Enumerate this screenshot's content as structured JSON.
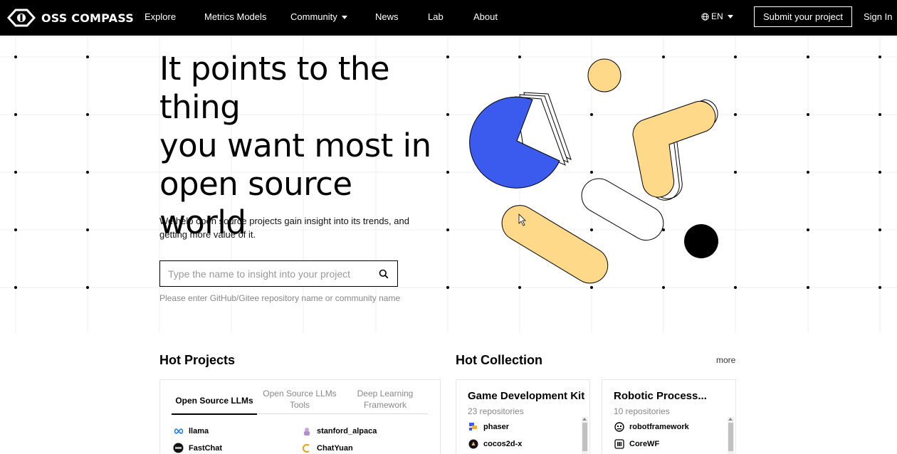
{
  "nav": {
    "brand": "OSS COMPASS",
    "items": [
      "Explore",
      "Metrics Models",
      "Community",
      "News",
      "Lab",
      "About"
    ],
    "lang": "EN",
    "submit": "Submit your project",
    "signin": "Sign In"
  },
  "hero": {
    "title_lines": [
      "It points to the",
      "thing",
      "you want most in",
      "open source world"
    ],
    "subtitle": "We help open source projects gain insight into its trends, and getting more value of it.",
    "search_placeholder": "Type the name to insight into your project",
    "hint": "Please enter GitHub/Gitee repository name or community name"
  },
  "hot_projects": {
    "title": "Hot Projects",
    "tabs": [
      "Open Source LLMs",
      "Open Source LLMs Tools",
      "Deep Learning Framework"
    ],
    "active_tab": 0,
    "items": [
      {
        "name": "llama",
        "icon": "meta-infinity-icon"
      },
      {
        "name": "stanford_alpaca",
        "icon": "alpaca-icon"
      },
      {
        "name": "FastChat",
        "icon": "lmsys-icon"
      },
      {
        "name": "ChatYuan",
        "icon": "chatyuan-icon"
      }
    ]
  },
  "hot_collection": {
    "title": "Hot Collection",
    "more": "more",
    "cards": [
      {
        "title": "Game Development Kit",
        "count": "23 repositories",
        "repos": [
          {
            "name": "phaser",
            "icon": "phaser-icon"
          },
          {
            "name": "cocos2d-x",
            "icon": "cocos-icon"
          }
        ]
      },
      {
        "title": "Robotic Process...",
        "count": "10 repositories",
        "repos": [
          {
            "name": "robotframework",
            "icon": "robot-icon"
          },
          {
            "name": "CoreWF",
            "icon": "corewf-icon"
          }
        ]
      }
    ]
  },
  "colors": {
    "accent_yellow": "#FFD98A",
    "accent_blue": "#3B5BEF",
    "nav_bg": "#000000"
  }
}
